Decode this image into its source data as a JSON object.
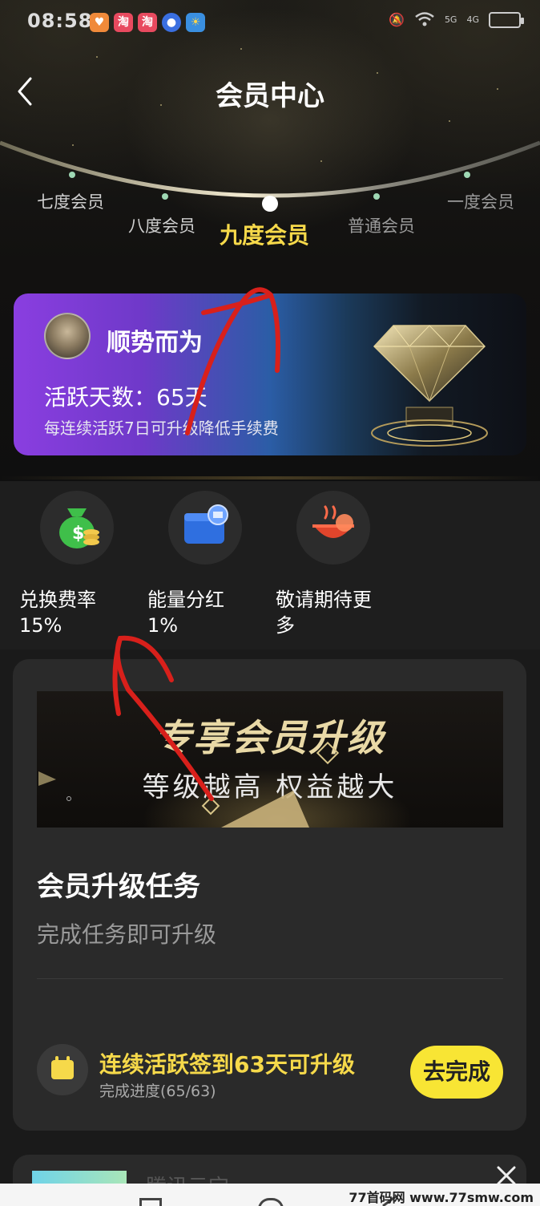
{
  "status_bar": {
    "time": "08:58",
    "app_icons": [
      "heart-app-icon",
      "taobao-icon",
      "taobao-icon",
      "blue-app-icon",
      "weather-icon"
    ],
    "taobao_glyph": "淘",
    "network_labels": [
      "5G",
      "4G"
    ]
  },
  "header": {
    "title": "会员中心"
  },
  "levels": {
    "items": [
      "七度会员",
      "八度会员",
      "九度会员",
      "普通会员",
      "一度会员"
    ],
    "active_index": 2
  },
  "member_card": {
    "username": "顺势而为",
    "active_days": "活跃天数：65天",
    "hint": "每连续活跃7日可升级降低手续费"
  },
  "perks": [
    {
      "label": "兑换费率",
      "value": "15%",
      "icon": "money-bag-icon"
    },
    {
      "label": "能量分红",
      "value": "1%",
      "icon": "wallet-icon"
    },
    {
      "label": "敬请期待更多",
      "value": "",
      "icon": "more-bowl-icon"
    }
  ],
  "banner": {
    "title": "专享会员升级",
    "subtitle": "等级越高 权益越大"
  },
  "task_section": {
    "title": "会员升级任务",
    "subtitle": "完成任务即可升级",
    "task_name": "连续活跃签到63天可升级",
    "progress": "完成进度(65/63)",
    "button_label": "去完成"
  },
  "next_card": {
    "title": "腾讯云宝"
  },
  "watermark": "77首码网 www.77smw.com",
  "colors": {
    "accent_yellow": "#f6d94a",
    "button_yellow": "#f8e534",
    "panel": "#2a2a2a",
    "annotation_red": "#d8201b"
  }
}
